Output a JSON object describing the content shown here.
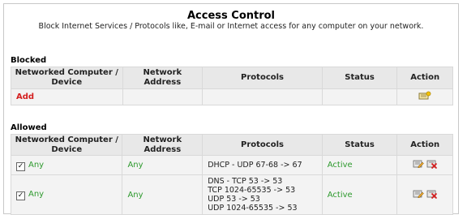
{
  "header": {
    "title": "Access Control",
    "subtitle": "Block Internet Services / Protocols like, E-mail or Internet access for any computer on your network."
  },
  "columns": {
    "device": "Networked Computer / Device",
    "address": "Network Address",
    "protocols": "Protocols",
    "status": "Status",
    "action": "Action"
  },
  "blocked": {
    "label": "Blocked",
    "add_label": "Add"
  },
  "allowed": {
    "label": "Allowed",
    "rows": [
      {
        "checked": true,
        "device": "Any",
        "address": "Any",
        "protocols": [
          "DHCP - UDP 67-68 -> 67"
        ],
        "status": "Active"
      },
      {
        "checked": true,
        "device": "Any",
        "address": "Any",
        "protocols": [
          "DNS - TCP 53 -> 53",
          "TCP 1024-65535 -> 53",
          "UDP 53 -> 53",
          "UDP 1024-65535 -> 53"
        ],
        "status": "Active"
      }
    ]
  },
  "icons": {
    "add": "add-rule-icon",
    "edit": "edit-rule-icon",
    "delete": "delete-rule-icon"
  },
  "colors": {
    "add_link": "#d42020",
    "active_status": "#2e9a2e",
    "header_bg": "#e8e8e8",
    "cell_bg": "#f3f3f3"
  }
}
